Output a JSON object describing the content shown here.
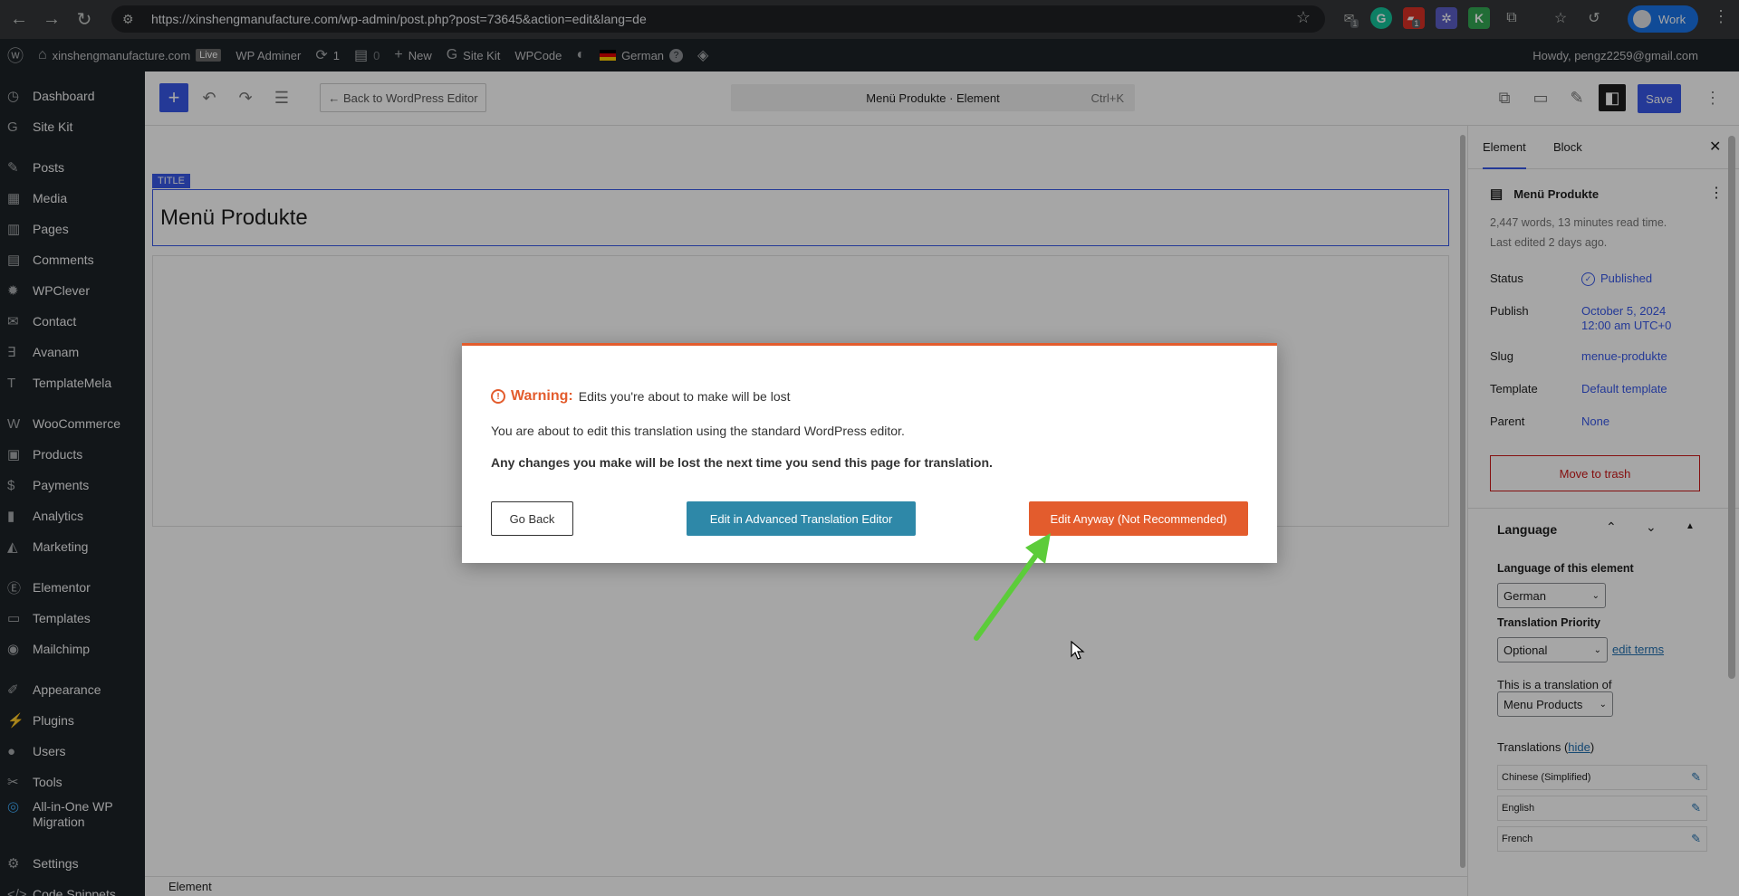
{
  "browser": {
    "url": "https://xinshengmanufacture.com/wp-admin/post.php?post=73645&action=edit&lang=de",
    "profile_label": "Work",
    "ext_badge_1": "1",
    "ext_badge_2": "1"
  },
  "adminbar": {
    "site": "xinshengmanufacture.com",
    "live": "Live",
    "wp_adminer": "WP Adminer",
    "updates": "1",
    "comments": "0",
    "new": "New",
    "sitekit": "Site Kit",
    "wpcode": "WPCode",
    "language": "German",
    "howdy": "Howdy, pengz2259@gmail.com"
  },
  "sidebar": {
    "items": [
      {
        "label": "Dashboard",
        "icon": "dashboard-icon"
      },
      {
        "label": "Site Kit",
        "icon": "g-icon"
      },
      {
        "label": "Posts",
        "icon": "pin-icon"
      },
      {
        "label": "Media",
        "icon": "media-icon"
      },
      {
        "label": "Pages",
        "icon": "pages-icon"
      },
      {
        "label": "Comments",
        "icon": "comment-icon"
      },
      {
        "label": "WPClever",
        "icon": "bulb-icon"
      },
      {
        "label": "Contact",
        "icon": "mail-icon"
      },
      {
        "label": "Avanam",
        "icon": "avanam-icon"
      },
      {
        "label": "TemplateMela",
        "icon": "tm-icon"
      },
      {
        "label": "WooCommerce",
        "icon": "woo-icon"
      },
      {
        "label": "Products",
        "icon": "box-icon"
      },
      {
        "label": "Payments",
        "icon": "dollar-icon"
      },
      {
        "label": "Analytics",
        "icon": "chart-icon"
      },
      {
        "label": "Marketing",
        "icon": "megaphone-icon"
      },
      {
        "label": "Elementor",
        "icon": "elementor-icon"
      },
      {
        "label": "Templates",
        "icon": "folder-icon"
      },
      {
        "label": "Mailchimp",
        "icon": "mailchimp-icon"
      },
      {
        "label": "Appearance",
        "icon": "brush-icon"
      },
      {
        "label": "Plugins",
        "icon": "plug-icon"
      },
      {
        "label": "Users",
        "icon": "user-icon"
      },
      {
        "label": "Tools",
        "icon": "wrench-icon"
      },
      {
        "label": "All-in-One WP Migration",
        "icon": "migration-icon"
      },
      {
        "label": "Settings",
        "icon": "settings-icon"
      },
      {
        "label": "Code Snippets",
        "icon": "code-icon"
      }
    ]
  },
  "toolbar": {
    "back_label": "← Back to WordPress Editor",
    "command_title": "Menü Produkte · Element",
    "command_shortcut": "Ctrl+K",
    "save_label": "Save"
  },
  "canvas": {
    "title_tag": "TITLE",
    "post_title": "Menü Produkte",
    "footer_label": "Element"
  },
  "settings": {
    "tab_element": "Element",
    "tab_block": "Block",
    "doc_title": "Menü Produkte",
    "meta_words": "2,447 words, 13 minutes read time.",
    "meta_edited": "Last edited 2 days ago.",
    "status_label": "Status",
    "status_value": "Published",
    "publish_label": "Publish",
    "publish_value_1": "October 5, 2024",
    "publish_value_2": "12:00 am UTC+0",
    "slug_label": "Slug",
    "slug_value": "menue-produkte",
    "template_label": "Template",
    "template_value": "Default template",
    "parent_label": "Parent",
    "parent_value": "None",
    "trash_label": "Move to trash",
    "language_heading": "Language",
    "language_of_element": "Language of this element",
    "language_value": "German",
    "priority_label": "Translation Priority",
    "priority_value": "Optional",
    "edit_terms": "edit terms",
    "translation_of_label": "This is a translation of",
    "translation_of_value": "Menu Products",
    "translations_label": "Translations",
    "hide_link": "hide",
    "translations": [
      "Chinese (Simplified)",
      "English",
      "French"
    ]
  },
  "modal": {
    "warning_label": "Warning:",
    "warning_text": "Edits you're about to make will be lost",
    "line1": "You are about to edit this translation using the standard WordPress editor.",
    "line2": "Any changes you make will be lost the next time you send this page for translation.",
    "go_back": "Go Back",
    "advanced": "Edit in Advanced Translation Editor",
    "anyway": "Edit Anyway (Not Recommended)"
  },
  "colors": {
    "accent": "#3858e9",
    "warning": "#e35c2d",
    "teal": "#2e88a8",
    "arrow": "#5ccc3a"
  }
}
